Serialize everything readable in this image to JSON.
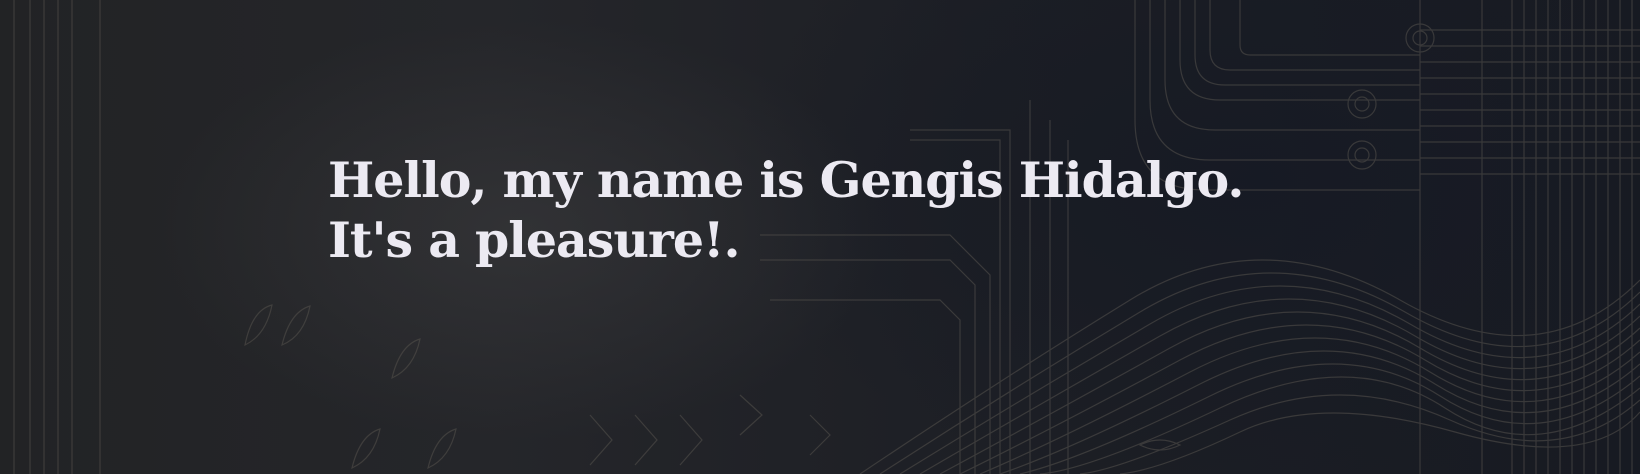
{
  "hero": {
    "line1": "Hello, my name is Gengis Hidalgo.",
    "line2": "It's a pleasure!."
  },
  "colors": {
    "background": "#1b1d22",
    "text": "#eceaf2",
    "pattern_lines": "#5a5650"
  },
  "decoration": {
    "pattern_icon": "circuit-pattern-icon"
  }
}
